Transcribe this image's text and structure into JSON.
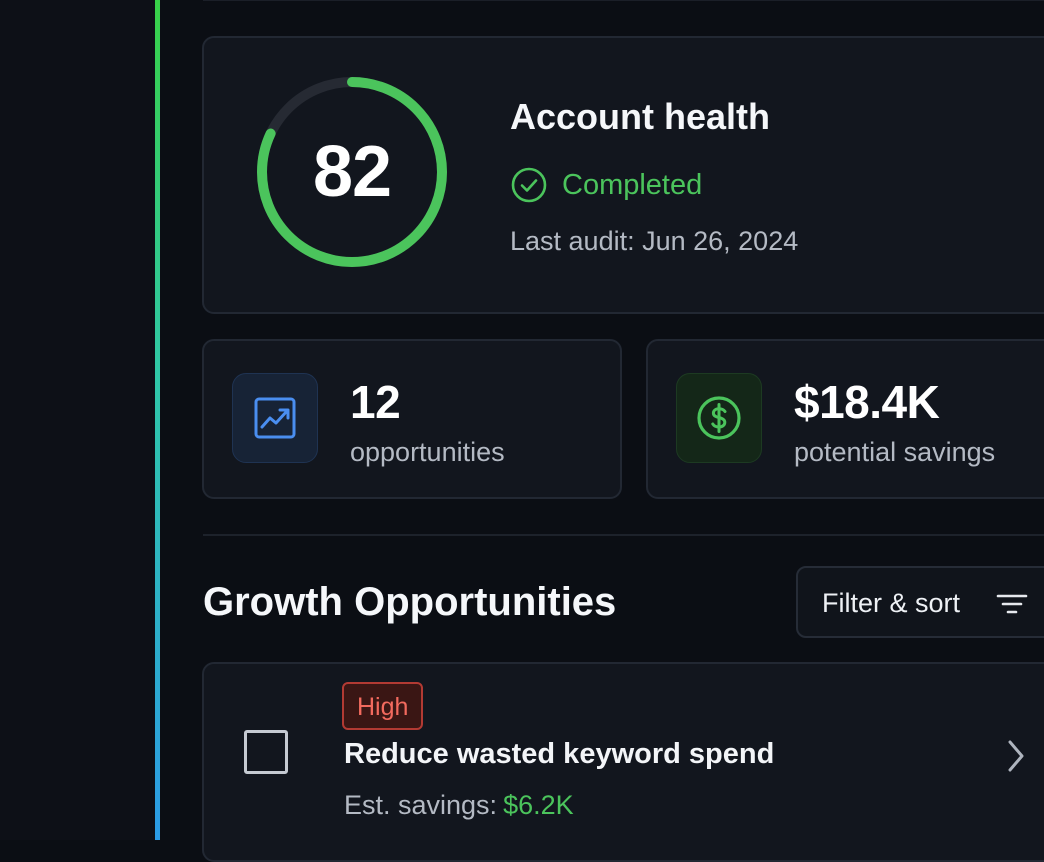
{
  "health": {
    "score": "82",
    "score_fraction": 0.82,
    "title": "Account health",
    "status": "Completed",
    "last_audit": "Last audit: Jun 26, 2024"
  },
  "stats": {
    "opportunities": {
      "value": "12",
      "label": "opportunities",
      "icon": "trending-up-chart-icon"
    },
    "savings": {
      "value": "$18.4K",
      "label": "potential savings",
      "icon": "dollar-circle-icon"
    }
  },
  "section": {
    "title": "Growth Opportunities",
    "filter_label": "Filter & sort"
  },
  "opportunities": [
    {
      "priority": "High",
      "title": "Reduce wasted keyword spend",
      "savings_label": "Est. savings:",
      "savings_value": "$6.2K"
    }
  ],
  "colors": {
    "accent_green": "#4bc45c",
    "accent_blue": "#3b82f6",
    "priority_high": "#f26a5e"
  }
}
